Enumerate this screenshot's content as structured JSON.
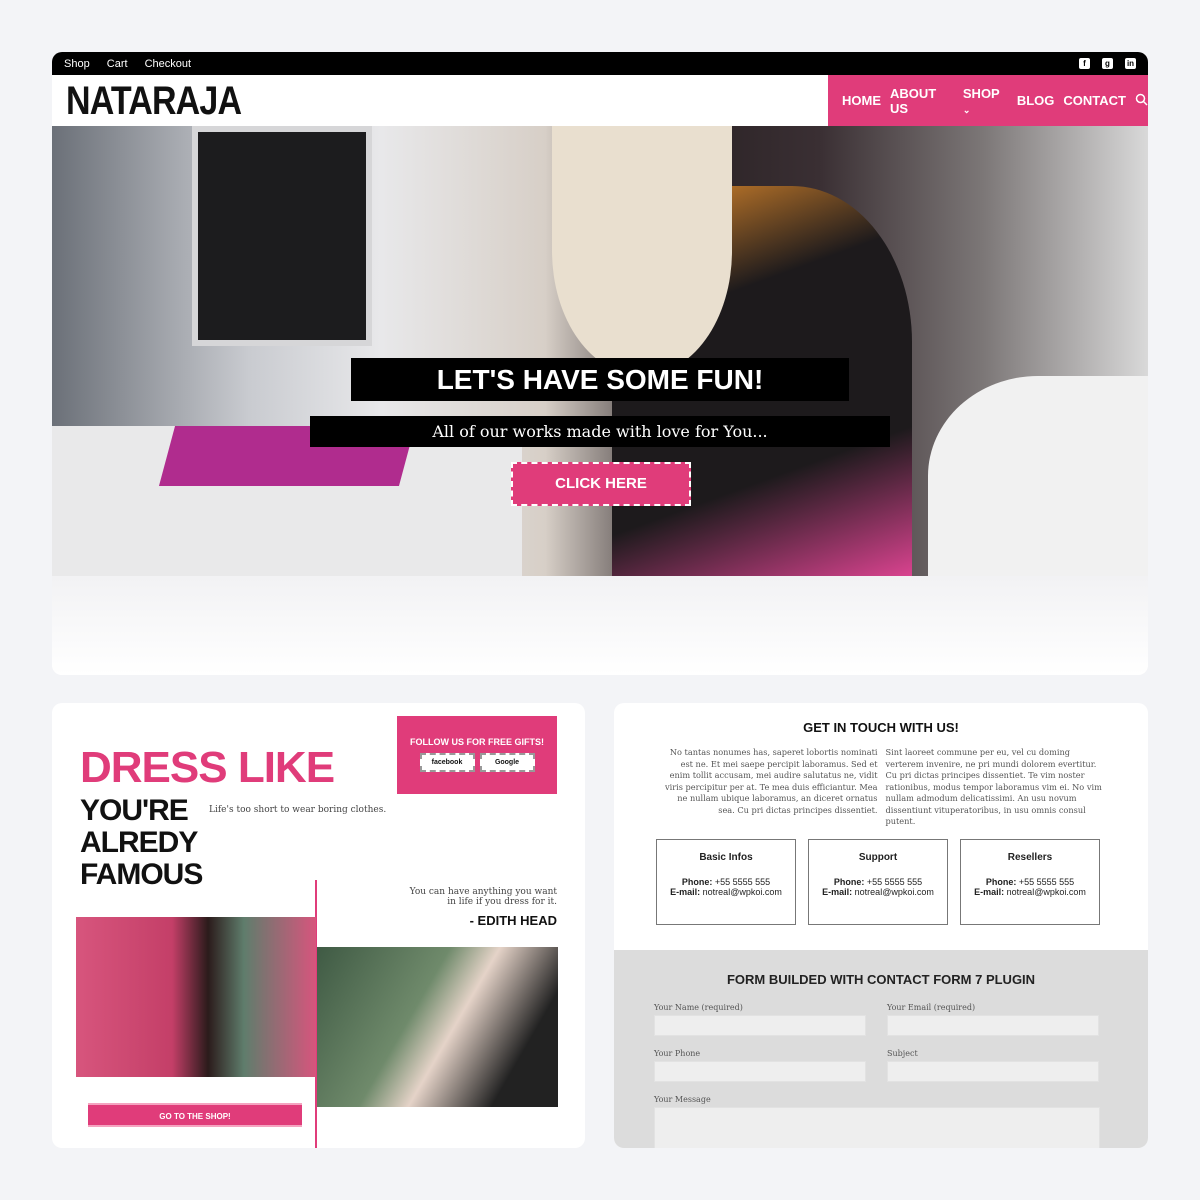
{
  "topbar": {
    "links": [
      "Shop",
      "Cart",
      "Checkout"
    ],
    "social": [
      "facebook-icon",
      "google-plus-icon",
      "linkedin-icon"
    ]
  },
  "header": {
    "logo": "NATARAJA",
    "nav": [
      "HOME",
      "ABOUT US",
      "SHOP",
      "BLOG",
      "CONTACT"
    ]
  },
  "hero": {
    "title": "LET'S HAVE SOME FUN!",
    "subtitle": "All of our works made with love for You...",
    "cta": "CLICK HERE"
  },
  "promo": {
    "headline1": "DRESS LIKE",
    "headline2": "YOU'RE ALREDY FAMOUS",
    "tagline": "Life's too short to wear boring clothes.",
    "follow_title": "FOLLOW US FOR FREE GIFTS!",
    "follow_buttons": [
      "facebook",
      "Google"
    ],
    "quote": "You can have anything you want in life if you dress for it.",
    "author": "- EDITH HEAD",
    "shop_button": "GO TO THE SHOP!"
  },
  "contact": {
    "title": "GET IN TOUCH WITH US!",
    "col1": "No tantas nonumes has, saperet lobortis nominati est ne. Et mei saepe percipit laboramus. Sed et enim tollit accusam, mei audire salutatus ne, vidit viris percipitur per at. Te mea duis efficiantur. Mea ne nullam ubique laboramus, an diceret ornatus sea. Cu pri dictas principes dissentiet.",
    "col2": "Sint laoreet commune per eu, vel cu doming verterem invenire, ne pri mundi dolorem evertitur. Cu pri dictas principes dissentiet. Te vim noster rationibus, modus tempor laboramus vim ei. No vim nullam admodum delicatissimi. An usu novum dissentiunt vituperatoribus, in usu omnis consul putent.",
    "boxes": [
      {
        "title": "Basic Infos",
        "phone_label": "Phone:",
        "phone": "+55 5555 555",
        "email_label": "E-mail:",
        "email": "notreal@wpkoi.com"
      },
      {
        "title": "Support",
        "phone_label": "Phone:",
        "phone": "+55 5555 555",
        "email_label": "E-mail:",
        "email": "notreal@wpkoi.com"
      },
      {
        "title": "Resellers",
        "phone_label": "Phone:",
        "phone": "+55 5555 555",
        "email_label": "E-mail:",
        "email": "notreal@wpkoi.com"
      }
    ],
    "form_title": "FORM BUILDED WITH CONTACT FORM 7 PLUGIN",
    "fields": [
      "Your Name (required)",
      "Your Email (required)",
      "Your Phone",
      "Subject",
      "Your Message"
    ]
  },
  "colors": {
    "accent": "#e03c7a",
    "dark": "#000000",
    "background": "#f3f4f7"
  }
}
